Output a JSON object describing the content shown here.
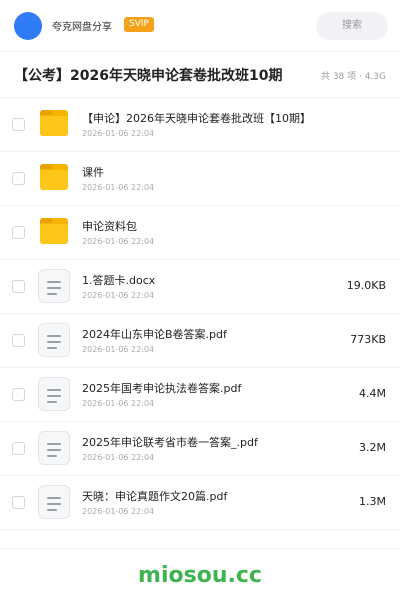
{
  "header": {
    "username": "夸克网盘分享",
    "badge": "SVIP",
    "search_label": "搜索"
  },
  "share": {
    "title": "【公考】2026年天晓申论套卷批改班10期",
    "meta": "共 38 项 · 4.3G"
  },
  "files": [
    {
      "type": "folder",
      "name": "【申论】2026年天晓申论套卷批改班【10期】",
      "date": "2026-01-06 22:04",
      "size": ""
    },
    {
      "type": "folder",
      "name": "课件",
      "date": "2026-01-06 22:04",
      "size": ""
    },
    {
      "type": "folder",
      "name": "申论资料包",
      "date": "2026-01-06 22:04",
      "size": ""
    },
    {
      "type": "doc",
      "name": "1.答题卡.docx",
      "date": "2026-01-06 22:04",
      "size": "19.0KB"
    },
    {
      "type": "doc",
      "name": "2024年山东申论B卷答案.pdf",
      "date": "2026-01-06 22:04",
      "size": "773KB"
    },
    {
      "type": "doc",
      "name": "2025年国考申论执法卷答案.pdf",
      "date": "2026-01-06 22:04",
      "size": "4.4M"
    },
    {
      "type": "doc",
      "name": "2025年申论联考省市卷一答案_.pdf",
      "date": "2026-01-06 22:04",
      "size": "3.2M"
    },
    {
      "type": "doc",
      "name": "天晓：申论真题作文20篇.pdf",
      "date": "2026-01-06 22:04",
      "size": "1.3M"
    }
  ],
  "footer": {
    "watermark": "miosou.cc"
  },
  "colors": {
    "avatar": "#2f7cf6",
    "badge": "#f5a21b",
    "folder": "#ffc61a",
    "watermark": "#3fb34f"
  }
}
